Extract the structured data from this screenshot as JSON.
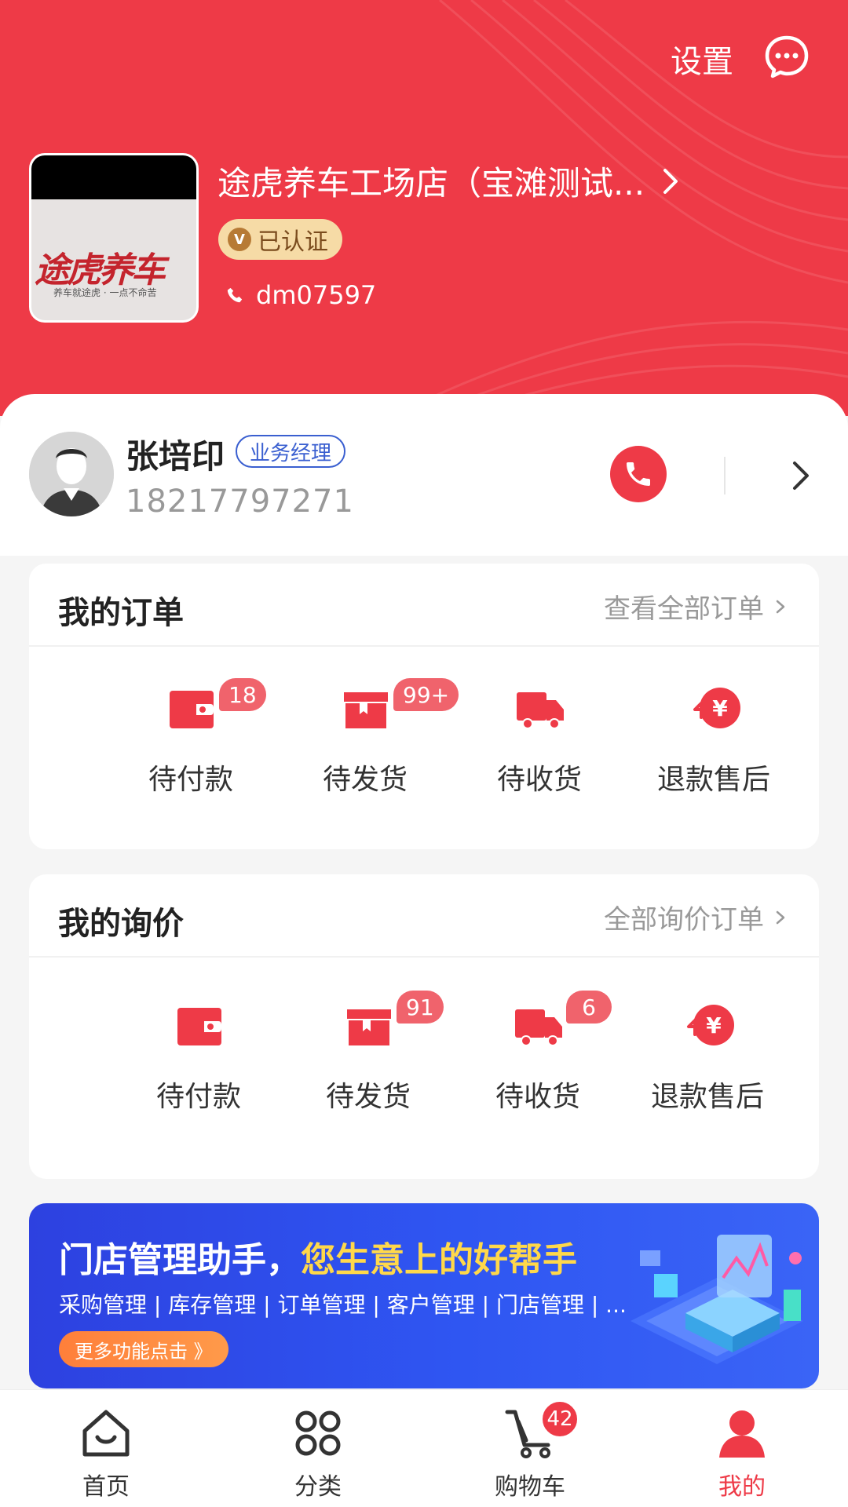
{
  "header": {
    "settings_label": "设置",
    "store_name": "途虎养车工场店（宝滩测试...",
    "verified_label": "已认证",
    "verified_mark": "V",
    "phone": "dm07597",
    "store_logo_text": "途虎养车",
    "store_logo_sub": "养车就途虎 · 一点不命苦"
  },
  "manager": {
    "name": "张培印",
    "role": "业务经理",
    "phone": "18217797271"
  },
  "orders": {
    "title": "我的订单",
    "link": "查看全部订单",
    "items": [
      {
        "label": "待付款",
        "icon": "wallet-icon",
        "badge": "18"
      },
      {
        "label": "待发货",
        "icon": "box-icon",
        "badge": "99+"
      },
      {
        "label": "待收货",
        "icon": "truck-icon",
        "badge": ""
      },
      {
        "label": "退款售后",
        "icon": "refund-icon",
        "badge": ""
      }
    ]
  },
  "inquiry": {
    "title": "我的询价",
    "link": "全部询价订单",
    "items": [
      {
        "label": "待付款",
        "icon": "wallet-icon",
        "badge": ""
      },
      {
        "label": "待发货",
        "icon": "box-icon",
        "badge": "91"
      },
      {
        "label": "待收货",
        "icon": "truck-icon",
        "badge": "6"
      },
      {
        "label": "退款售后",
        "icon": "refund-icon",
        "badge": ""
      }
    ]
  },
  "banner": {
    "title_part1": "门店管理助手，",
    "title_part2": "您生意上的好帮手",
    "subtitle": "采购管理 | 库存管理 | 订单管理 | 客户管理 | 门店管理 | ...",
    "button": "更多功能点击 》"
  },
  "tabbar": {
    "items": [
      {
        "label": "首页",
        "icon": "home-icon"
      },
      {
        "label": "分类",
        "icon": "category-icon"
      },
      {
        "label": "购物车",
        "icon": "cart-icon",
        "badge": "42"
      },
      {
        "label": "我的",
        "icon": "user-icon",
        "active": true
      }
    ]
  },
  "colors": {
    "primary_red": "#ee3a47",
    "badge_red": "#f0636c",
    "banner_blue": "#2f56f2",
    "role_blue": "#3a5fd0"
  }
}
